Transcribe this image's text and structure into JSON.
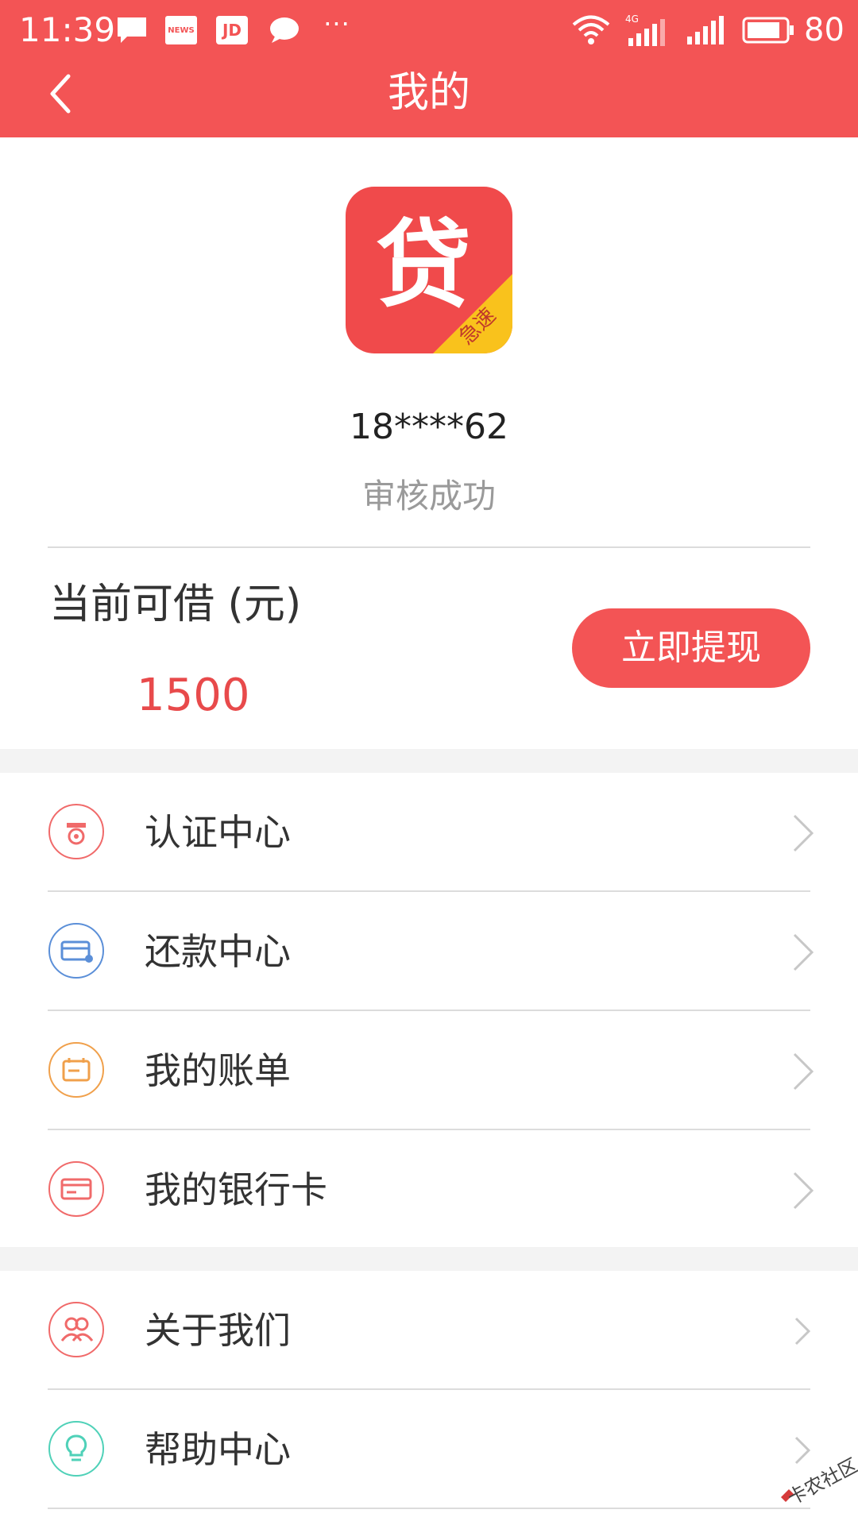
{
  "status_bar": {
    "time": "11:39",
    "battery": "80",
    "network": "4G",
    "notification_icons": [
      "message-icon",
      "news-icon",
      "jd-icon",
      "chat-icon",
      "more-icon"
    ],
    "news_badge": "NEWS",
    "jd_badge": "JD",
    "more": "···"
  },
  "header": {
    "title": "我的",
    "background": "#f35455"
  },
  "profile": {
    "logo_char": "贷",
    "logo_badge": "急速",
    "phone": "18****62",
    "status": "审核成功"
  },
  "credit": {
    "label": "当前可借 (元)",
    "amount": "1500",
    "button": "立即提现"
  },
  "menu_main": [
    {
      "label": "认证中心",
      "icon": "certification-icon",
      "color": "#f06a6a"
    },
    {
      "label": "还款中心",
      "icon": "repayment-icon",
      "color": "#5b8fd8"
    },
    {
      "label": "我的账单",
      "icon": "bill-icon",
      "color": "#f0a04b"
    },
    {
      "label": "我的银行卡",
      "icon": "bank-card-icon",
      "color": "#f06a6a"
    }
  ],
  "menu_secondary": [
    {
      "label": "关于我们",
      "icon": "about-us-icon",
      "color": "#f06a6a"
    },
    {
      "label": "帮助中心",
      "icon": "help-bulb-icon",
      "color": "#4fd1b8"
    }
  ],
  "watermark": "卡农社区"
}
